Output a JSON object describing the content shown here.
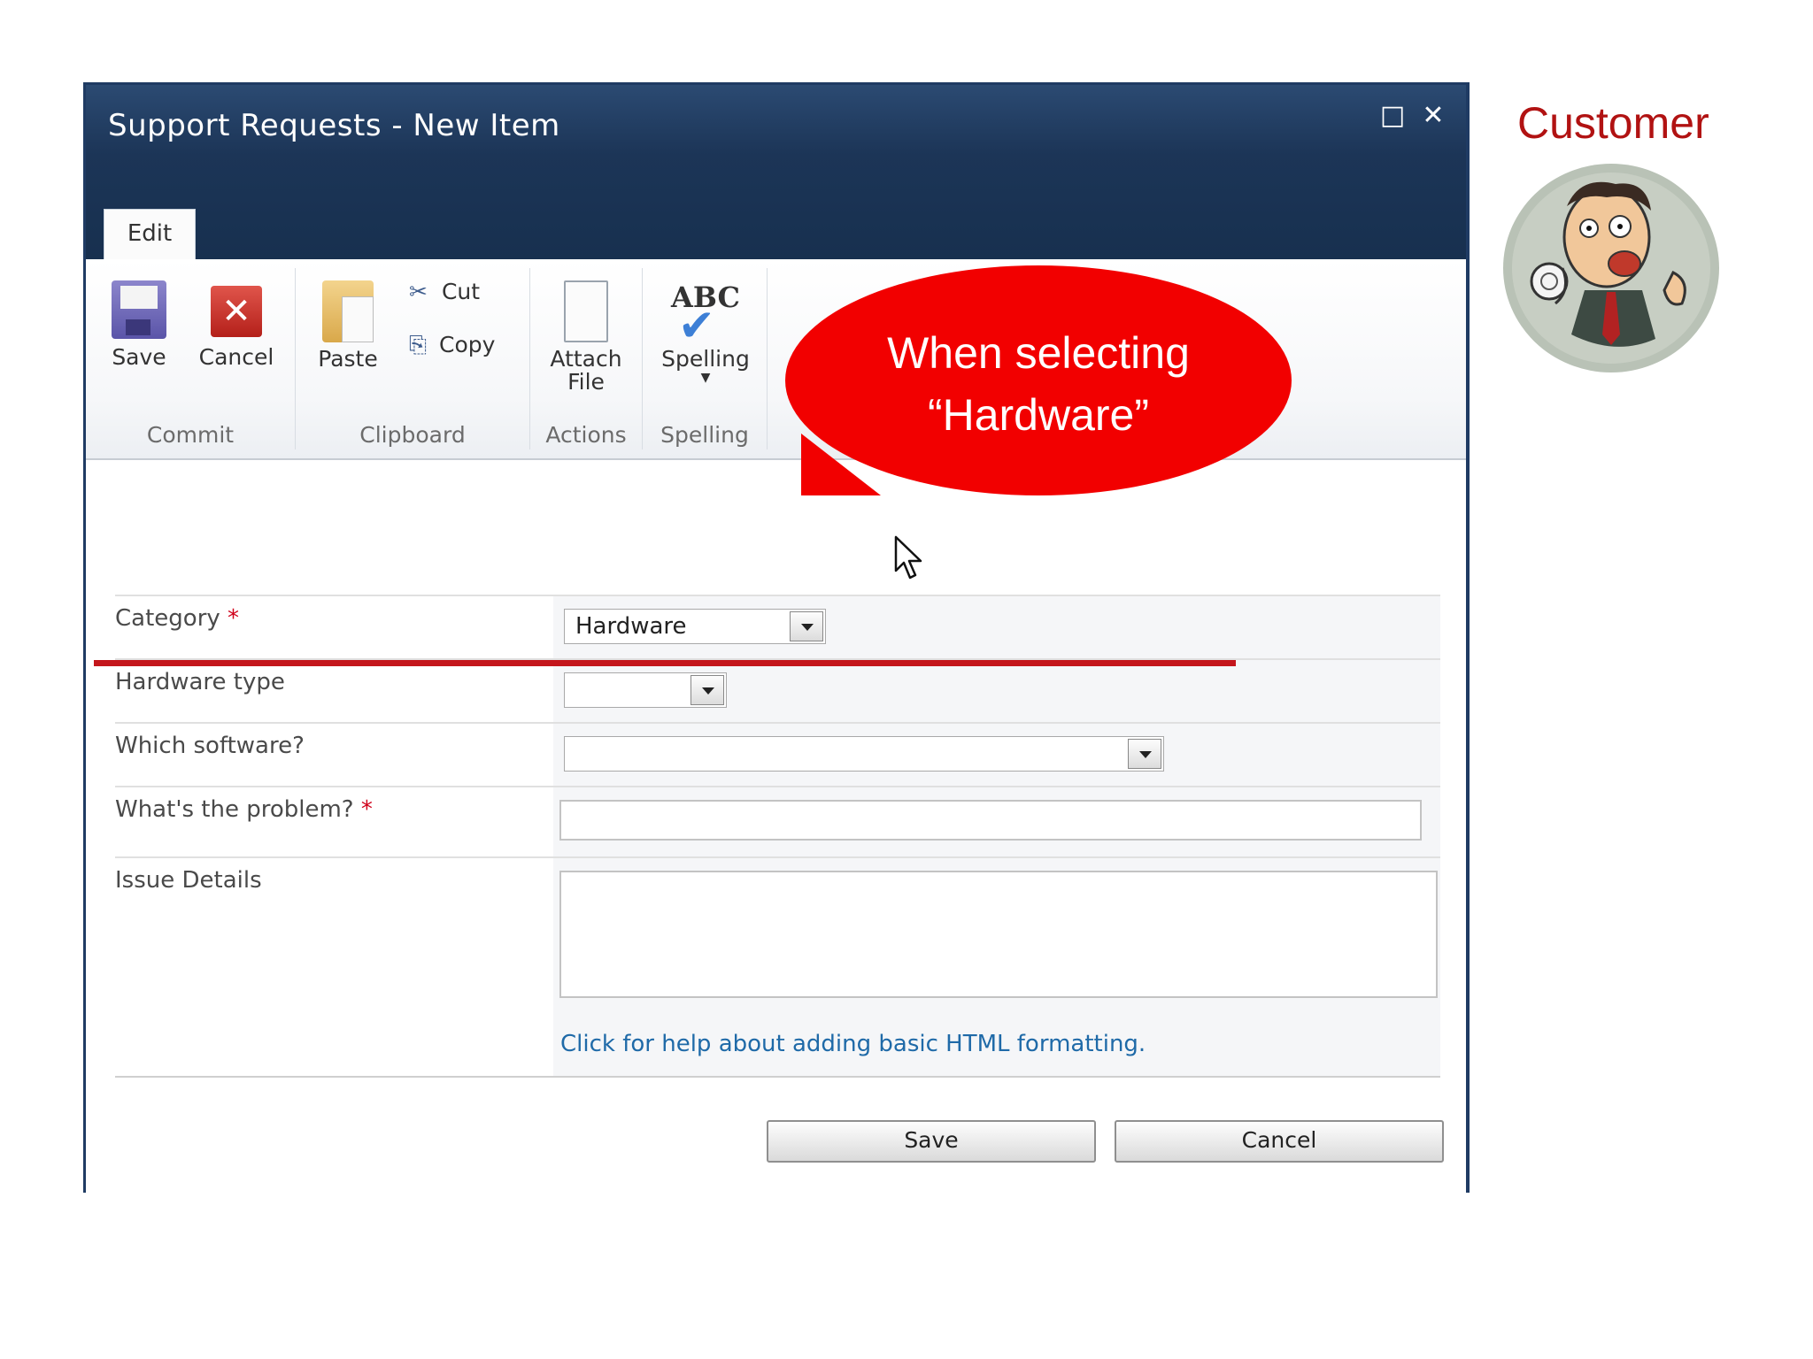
{
  "dialog": {
    "title": "Support Requests - New Item",
    "maximize_glyph": "□",
    "close_glyph": "✕"
  },
  "tabs": [
    {
      "label": "Edit"
    }
  ],
  "ribbon": {
    "groups": {
      "commit": "Commit",
      "clipboard": "Clipboard",
      "actions": "Actions",
      "spelling": "Spelling"
    },
    "buttons": {
      "save": "Save",
      "cancel": "Cancel",
      "paste": "Paste",
      "cut": "Cut",
      "copy": "Copy",
      "attach_line1": "Attach",
      "attach_line2": "File",
      "spelling": "Spelling",
      "abc": "ABC"
    }
  },
  "form": {
    "fields": {
      "category_label": "Category",
      "category_value": "Hardware",
      "hardware_type_label": "Hardware type",
      "which_software_label": "Which software?",
      "problem_label": "What's the problem?",
      "issue_details_label": "Issue Details",
      "required_mark": "*"
    },
    "help_link": "Click for help about adding basic HTML formatting.",
    "save_button": "Save",
    "cancel_button": "Cancel"
  },
  "callout": {
    "line1": "When selecting",
    "line2": "“Hardware”"
  },
  "customer": {
    "label": "Customer"
  },
  "colors": {
    "title_bar": "#1c3557",
    "callout": "#f20000",
    "strike_line": "#c4161c",
    "customer_label": "#b11212",
    "link": "#1f6aa8"
  }
}
